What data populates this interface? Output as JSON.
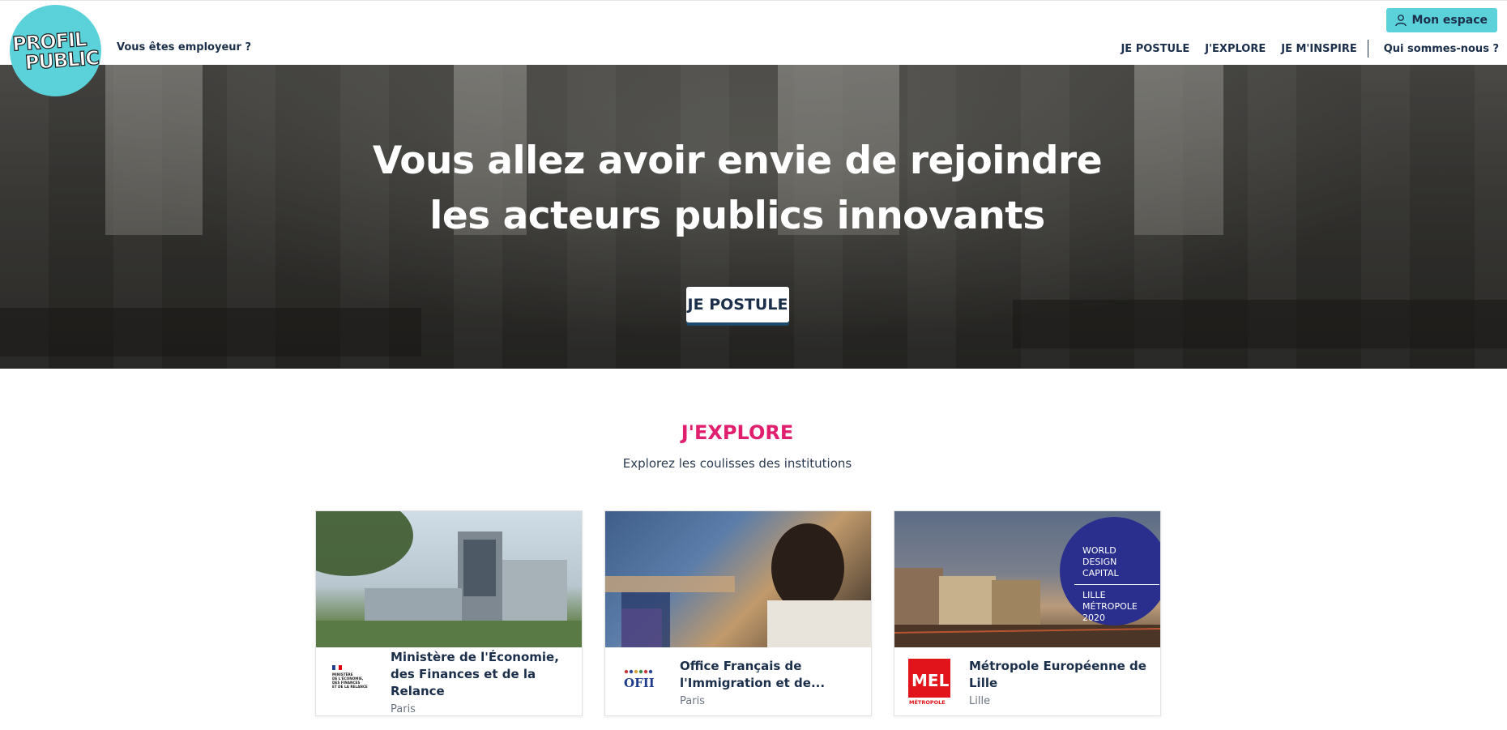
{
  "header": {
    "logo_line1": "PROFIL",
    "logo_line2": "PUBLIC",
    "employer_link": "Vous êtes employeur ?",
    "account_button": "Mon espace",
    "nav": [
      "JE POSTULE",
      "J'EXPLORE",
      "JE M'INSPIRE",
      "Qui sommes-nous ?"
    ]
  },
  "hero": {
    "title_line1": "Vous allez avoir envie de rejoindre",
    "title_line2": "les acteurs publics innovants",
    "cta": "JE POSTULE"
  },
  "explore": {
    "title": "J'EXPLORE",
    "subtitle": "Explorez les coulisses des institutions",
    "cards": [
      {
        "name": "Ministère de l'Économie, des Finances et de la Relance",
        "city": "Paris",
        "logo_text": "MINISTÈRE DE L'ÉCONOMIE, DES FINANCES ET DE LA RELANCE"
      },
      {
        "name": "Office Français de l'Immigration et de...",
        "city": "Paris",
        "logo_text": "OFII"
      },
      {
        "name": "Métropole Européenne de Lille",
        "city": "Lille",
        "logo_text": "MEL",
        "logo_subtext": "MÉTROPOLE",
        "badge_lines": [
          "WORLD",
          "DESIGN",
          "CAPITAL",
          "LILLE",
          "MÉTROPOLE",
          "2020"
        ]
      }
    ]
  },
  "colors": {
    "accent_turquoise": "#5bd1d9",
    "accent_pink": "#e0206e",
    "navy": "#1b2f4a"
  }
}
